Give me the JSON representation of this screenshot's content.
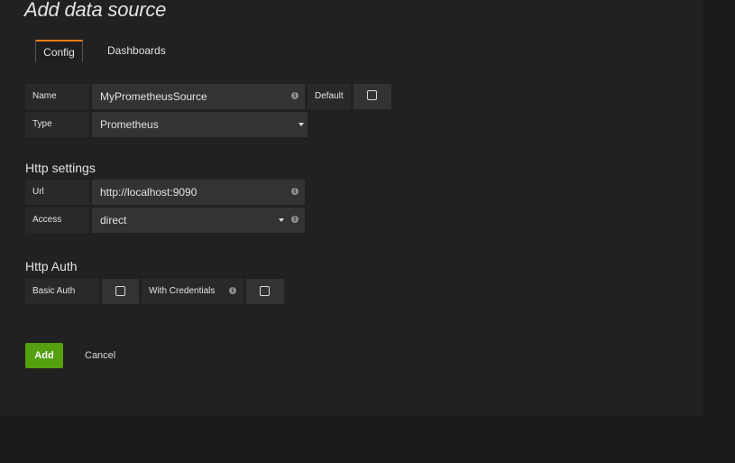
{
  "page": {
    "title": "Add data source"
  },
  "tabs": [
    {
      "label": "Config",
      "active": true
    },
    {
      "label": "Dashboards",
      "active": false
    }
  ],
  "general": {
    "name_label": "Name",
    "name_value": "MyPrometheusSource",
    "default_label": "Default",
    "default_checked": false,
    "type_label": "Type",
    "type_value": "Prometheus"
  },
  "http_settings": {
    "title": "Http settings",
    "url_label": "Url",
    "url_value": "http://localhost:9090",
    "access_label": "Access",
    "access_value": "direct"
  },
  "http_auth": {
    "title": "Http Auth",
    "basic_auth_label": "Basic Auth",
    "basic_auth_checked": false,
    "with_credentials_label": "With Credentials",
    "with_credentials_checked": false
  },
  "actions": {
    "add_label": "Add",
    "cancel_label": "Cancel"
  },
  "colors": {
    "accent_tab": "#eb7b18",
    "add_button": "#55a00f"
  }
}
